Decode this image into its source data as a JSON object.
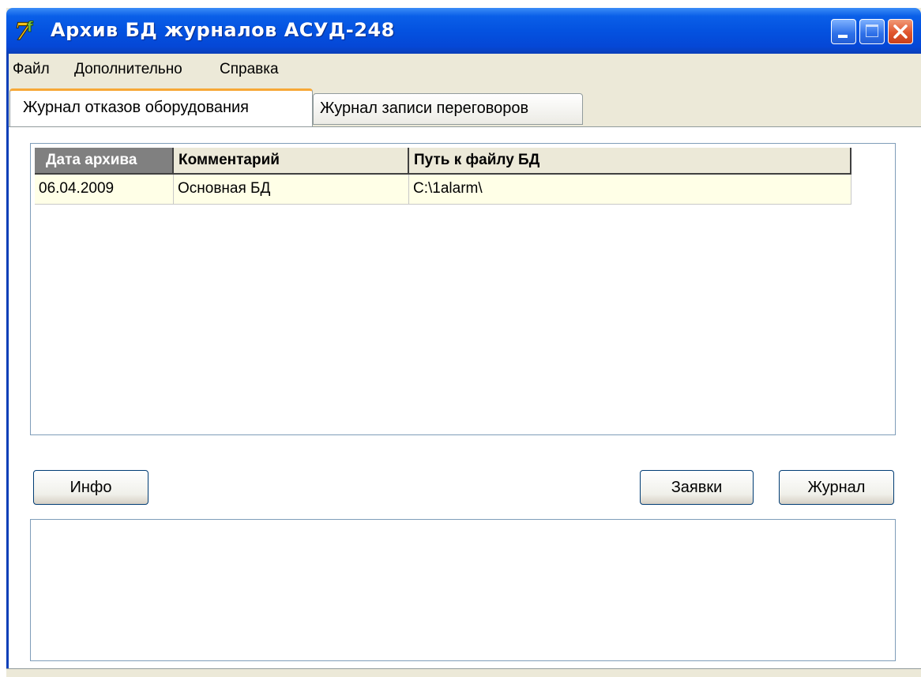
{
  "window": {
    "title": "Архив БД журналов АСУД-248",
    "icon": "app-logo-icon",
    "controls": {
      "minimize": "minimize-icon",
      "maximize": "maximize-icon",
      "close": "close-icon"
    }
  },
  "menu": {
    "items": [
      "Файл",
      "Дополнительно",
      "Справка"
    ]
  },
  "tabs": [
    {
      "label": "Журнал отказов оборудования",
      "active": true
    },
    {
      "label": "Журнал записи переговоров",
      "active": false
    }
  ],
  "archive_table": {
    "columns": [
      "Дата архива",
      "Комментарий",
      "Путь к файлу БД"
    ],
    "rows": [
      [
        "06.04.2009",
        "Основная БД",
        "C:\\1alarm\\"
      ]
    ]
  },
  "buttons": {
    "info": "Инфо",
    "requests": "Заявки",
    "journal": "Журнал"
  },
  "memo": {
    "text": ""
  },
  "colors": {
    "titlebar": "#0452e0",
    "tab_highlight": "#f7a837",
    "row_background": "#ffffe7",
    "window_face": "#ece9d8"
  }
}
